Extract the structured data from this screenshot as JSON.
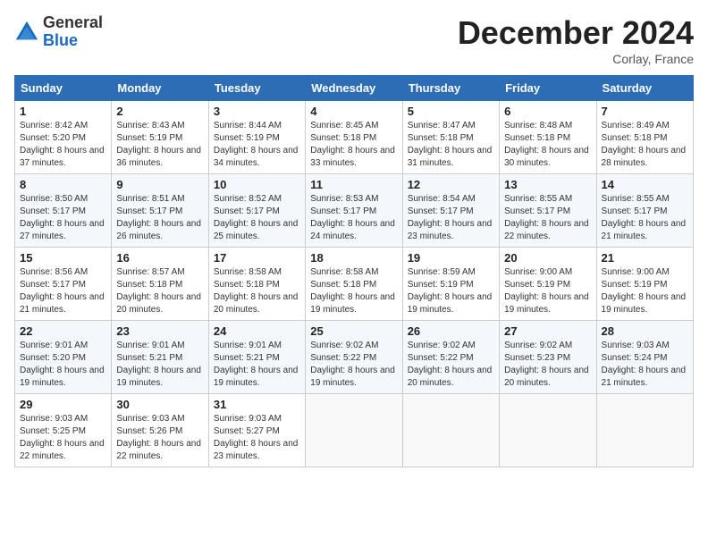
{
  "header": {
    "logo_general": "General",
    "logo_blue": "Blue",
    "month_title": "December 2024",
    "location": "Corlay, France"
  },
  "days_of_week": [
    "Sunday",
    "Monday",
    "Tuesday",
    "Wednesday",
    "Thursday",
    "Friday",
    "Saturday"
  ],
  "weeks": [
    [
      {
        "day": "1",
        "sunrise": "Sunrise: 8:42 AM",
        "sunset": "Sunset: 5:20 PM",
        "daylight": "Daylight: 8 hours and 37 minutes."
      },
      {
        "day": "2",
        "sunrise": "Sunrise: 8:43 AM",
        "sunset": "Sunset: 5:19 PM",
        "daylight": "Daylight: 8 hours and 36 minutes."
      },
      {
        "day": "3",
        "sunrise": "Sunrise: 8:44 AM",
        "sunset": "Sunset: 5:19 PM",
        "daylight": "Daylight: 8 hours and 34 minutes."
      },
      {
        "day": "4",
        "sunrise": "Sunrise: 8:45 AM",
        "sunset": "Sunset: 5:18 PM",
        "daylight": "Daylight: 8 hours and 33 minutes."
      },
      {
        "day": "5",
        "sunrise": "Sunrise: 8:47 AM",
        "sunset": "Sunset: 5:18 PM",
        "daylight": "Daylight: 8 hours and 31 minutes."
      },
      {
        "day": "6",
        "sunrise": "Sunrise: 8:48 AM",
        "sunset": "Sunset: 5:18 PM",
        "daylight": "Daylight: 8 hours and 30 minutes."
      },
      {
        "day": "7",
        "sunrise": "Sunrise: 8:49 AM",
        "sunset": "Sunset: 5:18 PM",
        "daylight": "Daylight: 8 hours and 28 minutes."
      }
    ],
    [
      {
        "day": "8",
        "sunrise": "Sunrise: 8:50 AM",
        "sunset": "Sunset: 5:17 PM",
        "daylight": "Daylight: 8 hours and 27 minutes."
      },
      {
        "day": "9",
        "sunrise": "Sunrise: 8:51 AM",
        "sunset": "Sunset: 5:17 PM",
        "daylight": "Daylight: 8 hours and 26 minutes."
      },
      {
        "day": "10",
        "sunrise": "Sunrise: 8:52 AM",
        "sunset": "Sunset: 5:17 PM",
        "daylight": "Daylight: 8 hours and 25 minutes."
      },
      {
        "day": "11",
        "sunrise": "Sunrise: 8:53 AM",
        "sunset": "Sunset: 5:17 PM",
        "daylight": "Daylight: 8 hours and 24 minutes."
      },
      {
        "day": "12",
        "sunrise": "Sunrise: 8:54 AM",
        "sunset": "Sunset: 5:17 PM",
        "daylight": "Daylight: 8 hours and 23 minutes."
      },
      {
        "day": "13",
        "sunrise": "Sunrise: 8:55 AM",
        "sunset": "Sunset: 5:17 PM",
        "daylight": "Daylight: 8 hours and 22 minutes."
      },
      {
        "day": "14",
        "sunrise": "Sunrise: 8:55 AM",
        "sunset": "Sunset: 5:17 PM",
        "daylight": "Daylight: 8 hours and 21 minutes."
      }
    ],
    [
      {
        "day": "15",
        "sunrise": "Sunrise: 8:56 AM",
        "sunset": "Sunset: 5:17 PM",
        "daylight": "Daylight: 8 hours and 21 minutes."
      },
      {
        "day": "16",
        "sunrise": "Sunrise: 8:57 AM",
        "sunset": "Sunset: 5:18 PM",
        "daylight": "Daylight: 8 hours and 20 minutes."
      },
      {
        "day": "17",
        "sunrise": "Sunrise: 8:58 AM",
        "sunset": "Sunset: 5:18 PM",
        "daylight": "Daylight: 8 hours and 20 minutes."
      },
      {
        "day": "18",
        "sunrise": "Sunrise: 8:58 AM",
        "sunset": "Sunset: 5:18 PM",
        "daylight": "Daylight: 8 hours and 19 minutes."
      },
      {
        "day": "19",
        "sunrise": "Sunrise: 8:59 AM",
        "sunset": "Sunset: 5:19 PM",
        "daylight": "Daylight: 8 hours and 19 minutes."
      },
      {
        "day": "20",
        "sunrise": "Sunrise: 9:00 AM",
        "sunset": "Sunset: 5:19 PM",
        "daylight": "Daylight: 8 hours and 19 minutes."
      },
      {
        "day": "21",
        "sunrise": "Sunrise: 9:00 AM",
        "sunset": "Sunset: 5:19 PM",
        "daylight": "Daylight: 8 hours and 19 minutes."
      }
    ],
    [
      {
        "day": "22",
        "sunrise": "Sunrise: 9:01 AM",
        "sunset": "Sunset: 5:20 PM",
        "daylight": "Daylight: 8 hours and 19 minutes."
      },
      {
        "day": "23",
        "sunrise": "Sunrise: 9:01 AM",
        "sunset": "Sunset: 5:21 PM",
        "daylight": "Daylight: 8 hours and 19 minutes."
      },
      {
        "day": "24",
        "sunrise": "Sunrise: 9:01 AM",
        "sunset": "Sunset: 5:21 PM",
        "daylight": "Daylight: 8 hours and 19 minutes."
      },
      {
        "day": "25",
        "sunrise": "Sunrise: 9:02 AM",
        "sunset": "Sunset: 5:22 PM",
        "daylight": "Daylight: 8 hours and 19 minutes."
      },
      {
        "day": "26",
        "sunrise": "Sunrise: 9:02 AM",
        "sunset": "Sunset: 5:22 PM",
        "daylight": "Daylight: 8 hours and 20 minutes."
      },
      {
        "day": "27",
        "sunrise": "Sunrise: 9:02 AM",
        "sunset": "Sunset: 5:23 PM",
        "daylight": "Daylight: 8 hours and 20 minutes."
      },
      {
        "day": "28",
        "sunrise": "Sunrise: 9:03 AM",
        "sunset": "Sunset: 5:24 PM",
        "daylight": "Daylight: 8 hours and 21 minutes."
      }
    ],
    [
      {
        "day": "29",
        "sunrise": "Sunrise: 9:03 AM",
        "sunset": "Sunset: 5:25 PM",
        "daylight": "Daylight: 8 hours and 22 minutes."
      },
      {
        "day": "30",
        "sunrise": "Sunrise: 9:03 AM",
        "sunset": "Sunset: 5:26 PM",
        "daylight": "Daylight: 8 hours and 22 minutes."
      },
      {
        "day": "31",
        "sunrise": "Sunrise: 9:03 AM",
        "sunset": "Sunset: 5:27 PM",
        "daylight": "Daylight: 8 hours and 23 minutes."
      },
      null,
      null,
      null,
      null
    ]
  ]
}
